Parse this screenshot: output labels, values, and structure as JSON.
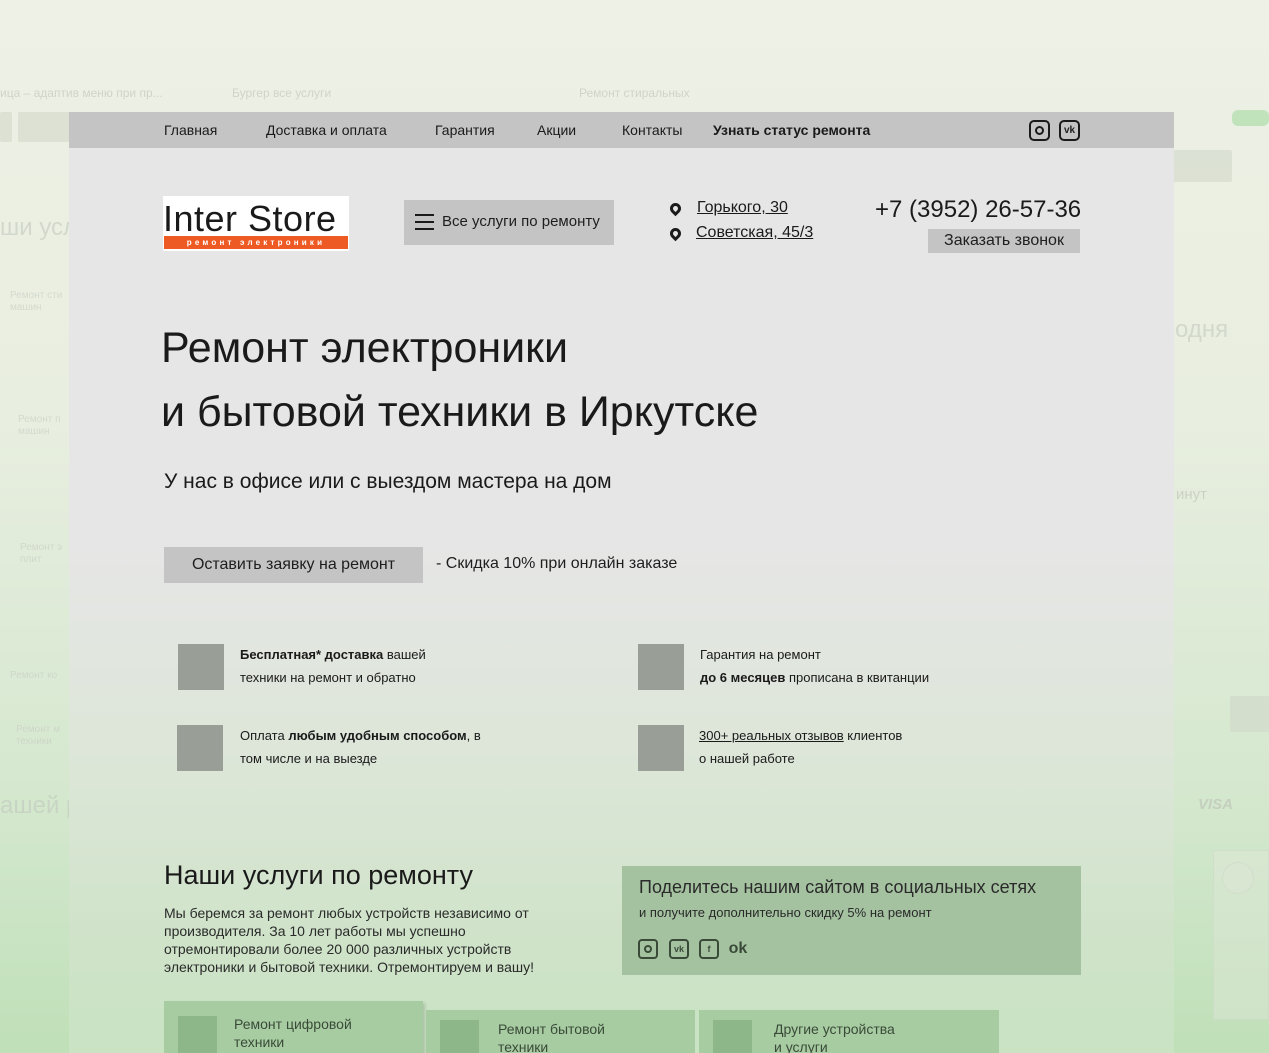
{
  "background_page": {
    "labels": [
      "ица – адаптив меню при пр...",
      "Бургер все услуги",
      "Ремонт стиральных"
    ],
    "left_heading_1": "ши услу",
    "left_heading_2": "ашей р",
    "right_heading": "одня",
    "right_minutes": "инут",
    "visa": "VISA"
  },
  "topnav": {
    "items": [
      "Главная",
      "Доставка и оплата",
      "Гарантия",
      "Акции",
      "Контакты",
      "Узнать статус ремонта"
    ],
    "icons": [
      "instagram-icon",
      "vk-icon"
    ]
  },
  "logo": {
    "name": "Inter Store",
    "tagline": "ремонт электроники"
  },
  "services_button": {
    "label": "Все услуги по ремонту"
  },
  "addresses": [
    "Горького, 30",
    "Советская, 45/3"
  ],
  "contact": {
    "phone": "+7 (3952) 26-57-36",
    "callback_label": "Заказать звонок"
  },
  "hero": {
    "title_line1": "Ремонт электроники",
    "title_line2": "и бытовой техники в Иркутске",
    "subtitle": "У нас в офисе или с выездом мастера на дом",
    "order_button": "Оставить заявку на ремонт",
    "discount": "- Скидка 10% при онлайн заказе"
  },
  "features": [
    {
      "bold": "Бесплатная* доставка",
      "rest": " вашей",
      "line2": "техники на ремонт и обратно"
    },
    {
      "pre": "Гарантия на ремонт",
      "bold": "до 6 месяцев",
      "rest": " прописана в квитанции"
    },
    {
      "pre": "Оплата ",
      "bold": "любым удобным способом",
      "rest": ", в",
      "line2": "том числе и на выезде"
    },
    {
      "link": "300+ реальных отзывов",
      "rest": " клиентов",
      "line2": "о нашей работе"
    }
  ],
  "services_section": {
    "title": "Наши услуги по ремонту",
    "description": "Мы беремся за ремонт любых устройств независимо от производителя. За 10 лет работы мы успешно отремонтировали более 20 000 различных устройств электроники и бытовой техники. Отремонтируем и вашу!"
  },
  "share": {
    "title": "Поделитесь нашим сайтом в социальных сетях",
    "subtitle": "и получите дополнительно скидку 5% на ремонт",
    "icons": [
      "instagram-icon",
      "vk-icon",
      "facebook-icon",
      "odnoklassniki-icon"
    ]
  },
  "service_cards": [
    {
      "line1": "Ремонт цифровой",
      "line2": "техники"
    },
    {
      "line1": "Ремонт бытовой",
      "line2": "техники"
    },
    {
      "line1": "Другие устройства",
      "line2": "и услуги"
    }
  ]
}
